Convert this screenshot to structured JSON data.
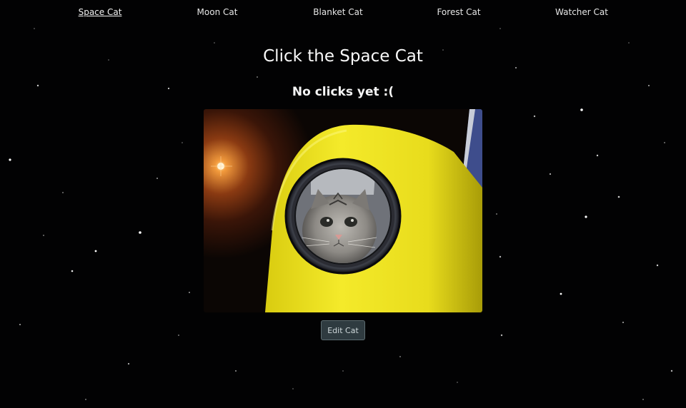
{
  "nav": {
    "items": [
      {
        "label": "Space Cat",
        "active": true
      },
      {
        "label": "Moon Cat",
        "active": false
      },
      {
        "label": "Blanket Cat",
        "active": false
      },
      {
        "label": "Forest Cat",
        "active": false
      },
      {
        "label": "Watcher Cat",
        "active": false
      }
    ]
  },
  "main": {
    "title": "Click the Space Cat",
    "click_status": "No clicks yet :(",
    "edit_label": "Edit Cat"
  },
  "colors": {
    "background": "#020203",
    "capsule_yellow": "#e8e020",
    "button_bg": "#2f3b40"
  }
}
